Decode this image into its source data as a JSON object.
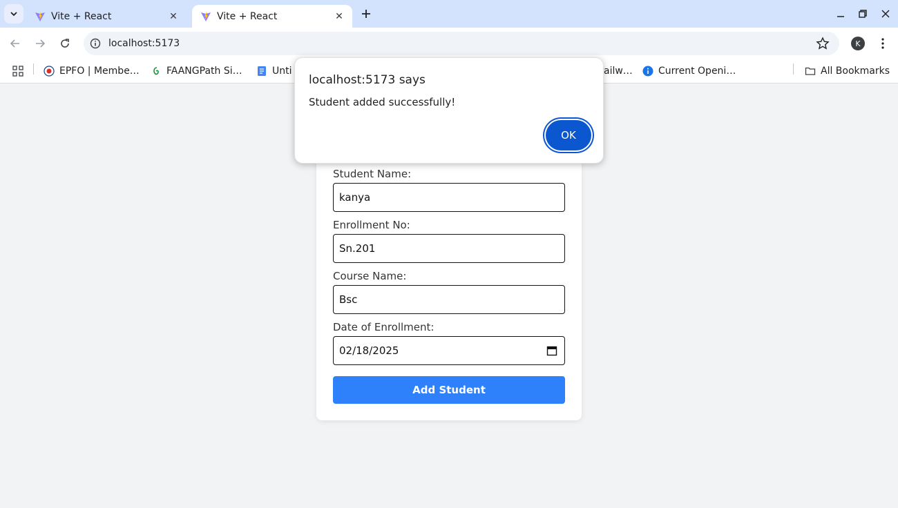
{
  "browser": {
    "tabs": [
      {
        "title": "Vite + React",
        "active": false
      },
      {
        "title": "Vite + React",
        "active": true
      }
    ],
    "url": "localhost:5173",
    "profile_initial": "K",
    "bookmarks": [
      {
        "label": "EPFO | Membe…",
        "icon": "epfo-icon"
      },
      {
        "label": "FAANGPath Si…",
        "icon": "faangpath-icon"
      },
      {
        "label": "Unti",
        "icon": "docs-icon"
      },
      {
        "label": "ailw…",
        "icon": ""
      },
      {
        "label": "Current Openi…",
        "icon": "info-blue-icon"
      }
    ],
    "all_bookmarks_label": "All Bookmarks"
  },
  "form": {
    "fields": [
      {
        "label": "Student Name:",
        "value": "kanya"
      },
      {
        "label": "Enrollment No:",
        "value": "Sn.201"
      },
      {
        "label": "Course Name:",
        "value": "Bsc"
      },
      {
        "label": "Date of Enrollment:",
        "value": "02/18/2025"
      }
    ],
    "submit_label": "Add Student"
  },
  "dialog": {
    "title": "localhost:5173 says",
    "message": "Student added successfully!",
    "ok_label": "OK"
  },
  "colors": {
    "tabstrip": "#d3e3fd",
    "primary_button": "#2f80fb",
    "dialog_ok": "#0b57d0"
  }
}
